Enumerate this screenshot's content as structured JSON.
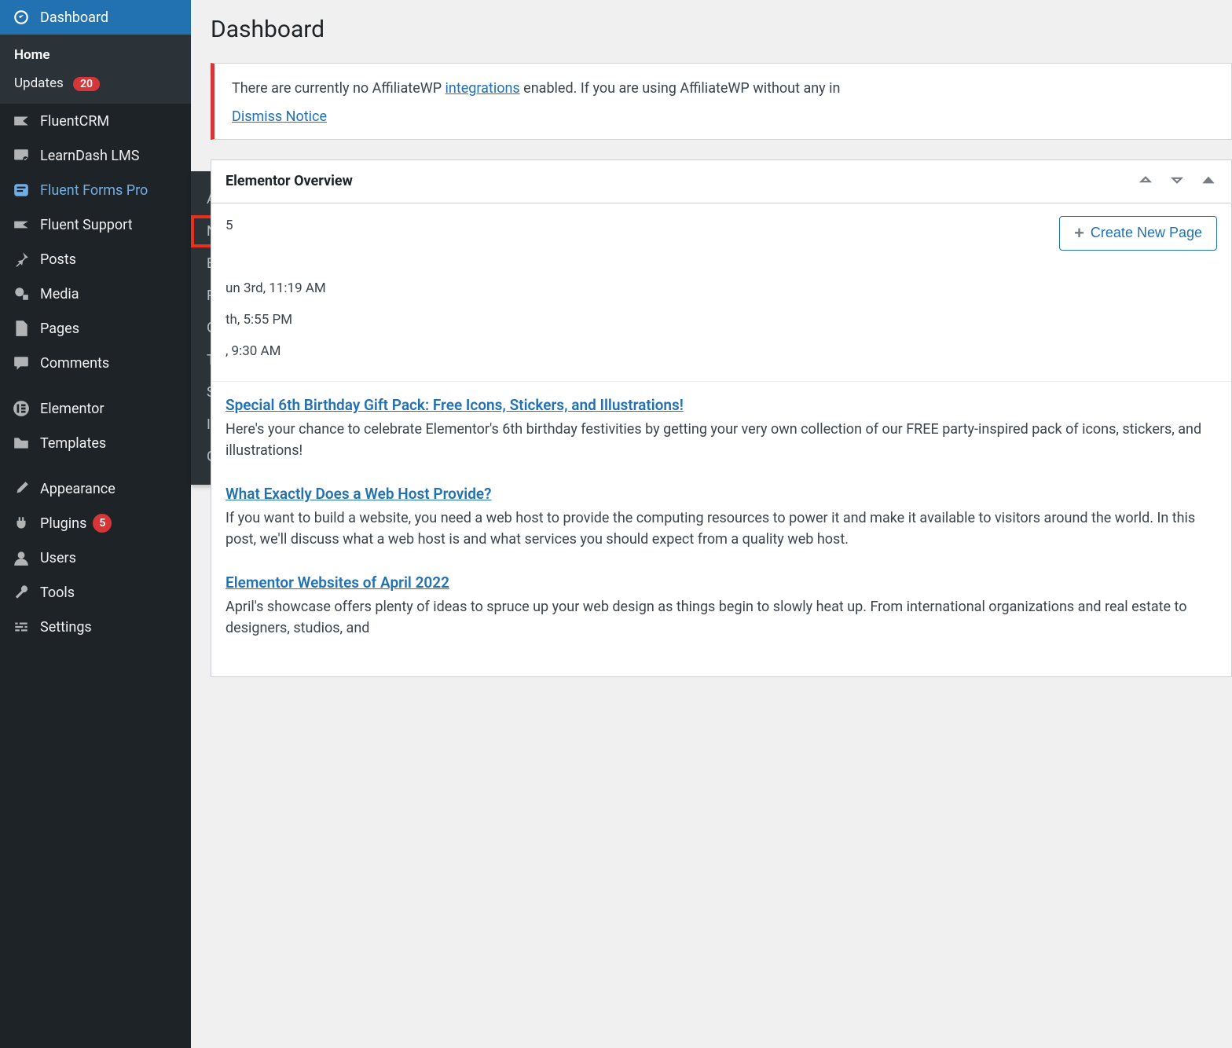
{
  "sidebar": {
    "dashboard": {
      "label": "Dashboard",
      "sub_home": "Home",
      "sub_updates": "Updates",
      "updates_badge": "20"
    },
    "items": [
      {
        "label": "FluentCRM"
      },
      {
        "label": "LearnDash LMS"
      },
      {
        "label": "Fluent Forms Pro"
      },
      {
        "label": "Fluent Support"
      },
      {
        "label": "Posts"
      },
      {
        "label": "Media"
      },
      {
        "label": "Pages"
      },
      {
        "label": "Comments"
      },
      {
        "label": "Elementor"
      },
      {
        "label": "Templates"
      },
      {
        "label": "Appearance"
      },
      {
        "label": "Plugins",
        "badge": "5"
      },
      {
        "label": "Users"
      },
      {
        "label": "Tools"
      },
      {
        "label": "Settings"
      }
    ],
    "flyout": [
      "All Forms",
      "New Form",
      "Entries",
      "Payments",
      "Global Settings",
      "Tools",
      "SMTP",
      "Integration Modules",
      "Get Help"
    ]
  },
  "main": {
    "title": "Dashboard",
    "notice": {
      "text_prefix": "There are currently no AffiliateWP ",
      "link": "integrations",
      "text_suffix": " enabled. If you are using AffiliateWP without any in",
      "dismiss": "Dismiss Notice"
    },
    "overview": {
      "title": "Elementor Overview",
      "version_suffix": "5",
      "create_btn": "Create New Page",
      "edited": [
        "un 3rd, 11:19 AM",
        "th, 5:55 PM",
        ", 9:30 AM"
      ]
    },
    "news": [
      {
        "title": "Special 6th Birthday Gift Pack: Free Icons, Stickers, and Illustrations!",
        "desc": "Here's your chance to celebrate Elementor's 6th birthday festivities by getting your very own collection of our FREE party-inspired pack of icons, stickers, and illustrations!"
      },
      {
        "title": "What Exactly Does a Web Host Provide?",
        "desc": "If you want to build a website, you need a web host to provide the computing resources to power it and make it available to visitors around the world. In this post, we'll discuss what a web host is and what services you should expect from a quality web host."
      },
      {
        "title": "Elementor Websites of April 2022",
        "desc": "April's showcase offers plenty of ideas to spruce up your web design as things begin to slowly heat up. From international organizations and real estate to designers, studios, and"
      }
    ]
  }
}
